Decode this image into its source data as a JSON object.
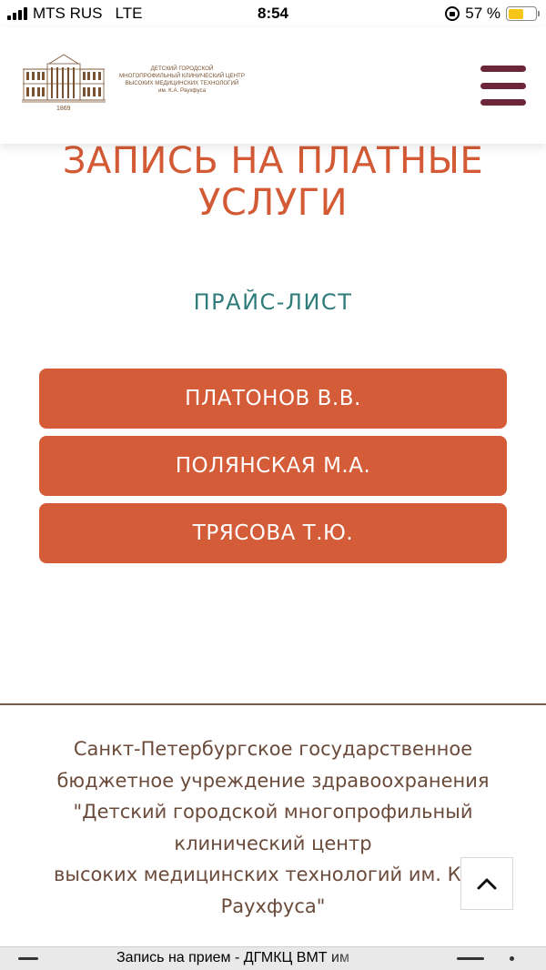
{
  "status_bar": {
    "carrier": "MTS RUS",
    "network": "LTE",
    "time": "8:54",
    "battery_percent": "57 %",
    "battery_level": 0.57,
    "battery_color": "#f5c518"
  },
  "header": {
    "logo": {
      "name_lines": [
        "ДЕТСКИЙ ГОРОДСКОЙ",
        "МНОГОПРОФИЛЬНЫЙ КЛИНИЧЕСКИЙ ЦЕНТР",
        "ВЫСОКИХ МЕДИЦИНСКИХ ТЕХНОЛОГИЙ",
        "им. К.А. Раухфуса"
      ],
      "year": "1869"
    },
    "menu_icon": "hamburger-icon",
    "menu_color": "#6b2639"
  },
  "main": {
    "title_lines": [
      "ЗАПИСЬ НА ПЛАТНЫЕ",
      "УСЛУГИ"
    ],
    "price_list_label": "ПРАЙС-ЛИСТ",
    "doctors": [
      "ПЛАТОНОВ В.В.",
      "ПОЛЯНСКАЯ М.А.",
      "ТРЯСОВА Т.Ю."
    ],
    "accent_color": "#d45c38",
    "teal_color": "#2f7c7b"
  },
  "footer": {
    "lines": [
      "Санкт-Петербургское государственное",
      "бюджетное учреждение здравоохранения",
      "\"Детский городской многопрофильный",
      "клинический центр",
      "высоких медицинских технологий им. К. А.",
      "Раухфуса\""
    ],
    "scroll_top_icon": "chevron-up-icon"
  },
  "browser_bar": {
    "page_title": "Запись на прием - ДГМКЦ ВМТ им"
  }
}
